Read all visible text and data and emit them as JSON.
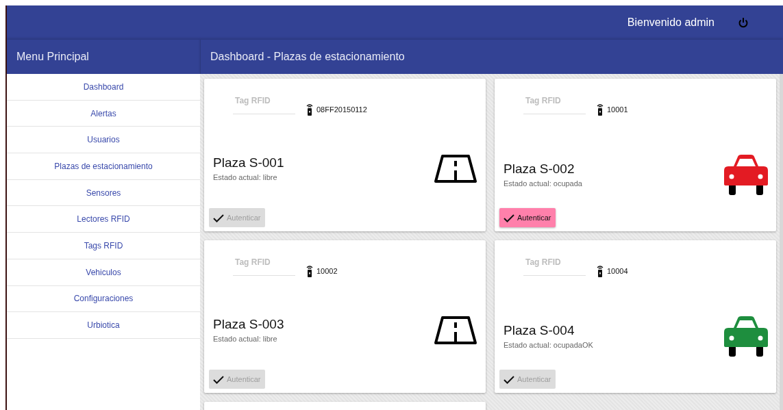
{
  "topbar": {
    "welcome": "Bienvenido admin"
  },
  "sidebar": {
    "title": "Menu Principal",
    "items": [
      {
        "label": "Dashboard"
      },
      {
        "label": "Alertas"
      },
      {
        "label": "Usuarios"
      },
      {
        "label": "Plazas de estacionamiento"
      },
      {
        "label": "Sensores"
      },
      {
        "label": "Lectores RFID"
      },
      {
        "label": "Tags RFID"
      },
      {
        "label": "Vehiculos"
      },
      {
        "label": "Configuraciones"
      },
      {
        "label": "Urbiotica"
      }
    ]
  },
  "page_title": "Dashboard - Plazas de estacionamiento",
  "spots": [
    {
      "tag_placeholder": "Tag RFID",
      "tag": "08FF20150112",
      "name": "Plaza S-001",
      "status": "Estado actual: libre",
      "kind": "free",
      "button": {
        "label": "Autenticar",
        "disabled": true
      }
    },
    {
      "tag_placeholder": "Tag RFID",
      "tag": "10001",
      "name": "Plaza S-002",
      "status": "Estado actual: ocupada",
      "kind": "car",
      "color": "#e31b23",
      "button": {
        "label": "Autenticar",
        "disabled": false
      }
    },
    {
      "tag_placeholder": "Tag RFID",
      "tag": "10002",
      "name": "Plaza S-003",
      "status": "Estado actual: libre",
      "kind": "free",
      "button": {
        "label": "Autenticar",
        "disabled": true
      }
    },
    {
      "tag_placeholder": "Tag RFID",
      "tag": "10004",
      "name": "Plaza S-004",
      "status": "Estado actual: ocupadaOK",
      "kind": "car",
      "color": "#1e8e3e",
      "button": {
        "label": "Autenticar",
        "disabled": true
      }
    }
  ]
}
